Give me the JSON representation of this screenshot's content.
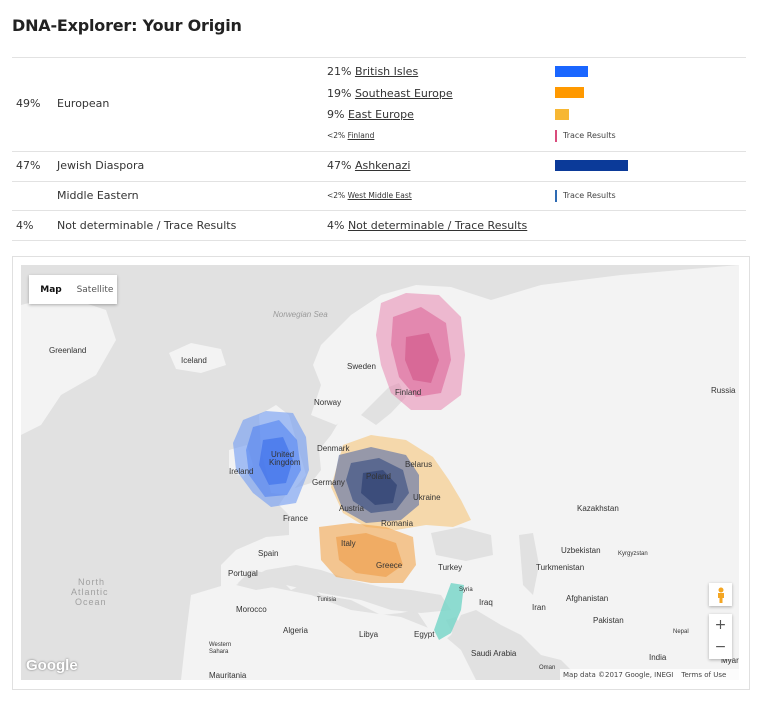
{
  "title": "DNA-Explorer: Your Origin",
  "rows": [
    {
      "pct": "49%",
      "region": "European"
    },
    {
      "pct": "47%",
      "region": "Jewish Diaspora"
    },
    {
      "pct": "",
      "region": "Middle Eastern"
    },
    {
      "pct": "4%",
      "region": "Not determinable / Trace Results"
    }
  ],
  "subs": [
    {
      "pct": "21%",
      "name": "British Isles",
      "color": "#1a66ff",
      "value": 21
    },
    {
      "pct": "19%",
      "name": "Southeast Europe",
      "color": "#ff9900",
      "value": 19
    },
    {
      "pct": "9%",
      "name": "East Europe",
      "color": "#f7b733",
      "value": 9
    },
    {
      "pct": "<2%",
      "name": "Finland",
      "color": "#d94c7c",
      "trace": "Trace Results"
    },
    {
      "pct": "47%",
      "name": "Ashkenazi",
      "color": "#0b3a99",
      "value": 47
    },
    {
      "pct": "<2%",
      "name": "West Middle East",
      "color": "#2e6bb3",
      "trace": "Trace Results"
    },
    {
      "pct": "4%",
      "name": "Not determinable / Trace Results"
    }
  ],
  "map": {
    "tabs": [
      "Map",
      "Satellite"
    ],
    "active_tab": "Map",
    "zoom_in": "+",
    "zoom_out": "−",
    "logo": "Google",
    "attribution": "Map data ©2017 Google, INEGI",
    "terms": "Terms of Use",
    "labels": {
      "norwegian_sea": "Norwegian Sea",
      "greenland": "Greenland",
      "iceland": "Iceland",
      "sweden": "Sweden",
      "finland": "Finland",
      "norway": "Norway",
      "russia": "Russia",
      "denmark": "Denmark",
      "uk": "United",
      "uk2": "Kingdom",
      "ireland": "Ireland",
      "belarus": "Belarus",
      "germany": "Germany",
      "poland": "Poland",
      "ukraine": "Ukraine",
      "austria": "Austria",
      "france": "France",
      "romania": "Romania",
      "kazakhstan": "Kazakhstan",
      "spain": "Spain",
      "italy": "Italy",
      "portugal": "Portugal",
      "greece": "Greece",
      "turkey": "Turkey",
      "uzbekistan": "Uzbekistan",
      "kyrgyzstan": "Kyrgyzstan",
      "turkmenistan": "Turkmenistan",
      "north": "North",
      "atlantic": "Atlantic",
      "ocean": "Ocean",
      "tunisia": "Tunisia",
      "syria": "Syria",
      "iraq": "Iraq",
      "iran": "Iran",
      "afghanistan": "Afghanistan",
      "morocco": "Morocco",
      "algeria": "Algeria",
      "libya": "Libya",
      "egypt": "Egypt",
      "pakistan": "Pakistan",
      "western": "Western",
      "sahara": "Sahara",
      "saudi": "Saudi Arabia",
      "oman": "Oman",
      "india": "India",
      "nepal": "Nepal",
      "mauritania": "Mauritania",
      "myanmar": "Myar"
    }
  }
}
